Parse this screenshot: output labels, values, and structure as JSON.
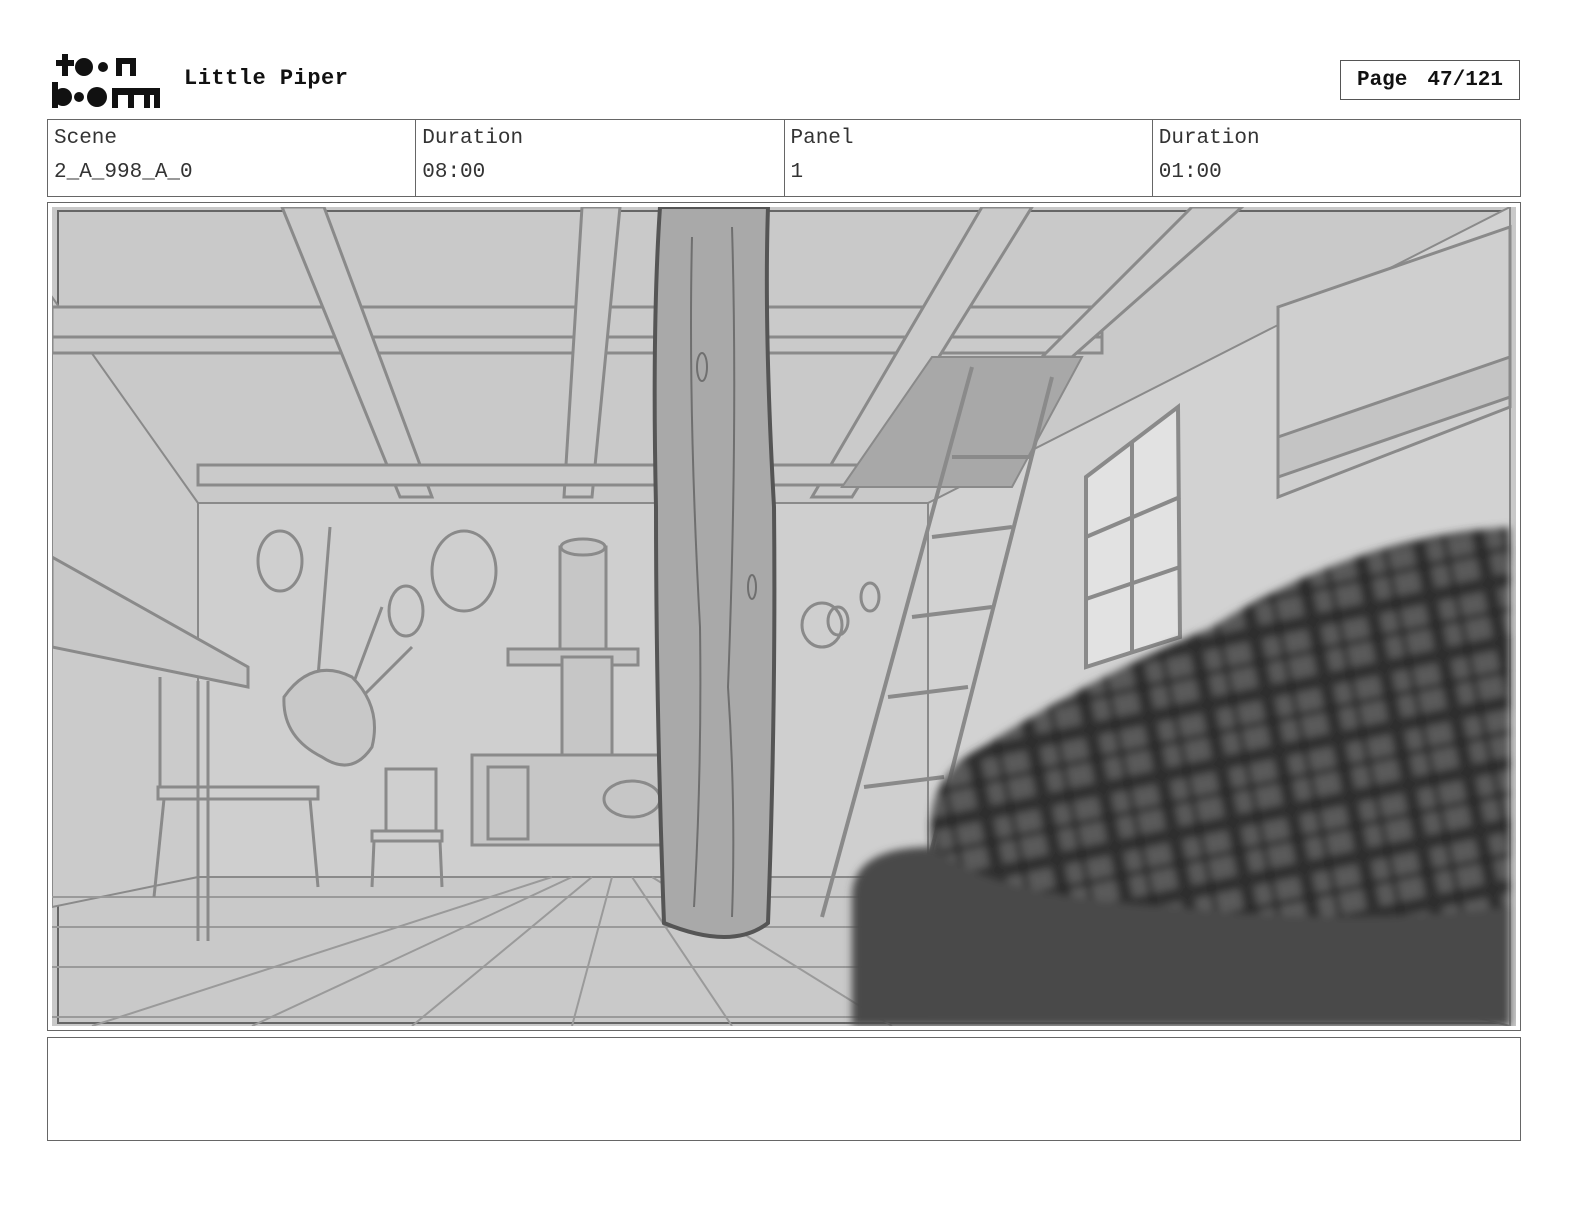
{
  "header": {
    "logo_alt": "toon boom",
    "project_title": "Little Piper",
    "page_label": "Page",
    "page_value": "47/121"
  },
  "info": [
    {
      "label": "Scene",
      "value": "2_A_998_A_0"
    },
    {
      "label": "Duration",
      "value": "08:00"
    },
    {
      "label": "Panel",
      "value": "1"
    },
    {
      "label": "Duration",
      "value": "01:00"
    }
  ],
  "notes": {
    "text": ""
  },
  "colors": {
    "sketch_bg": "#c9c9c9",
    "line": "#8a8a8a",
    "dark": "#333333",
    "plaid": "#4a4a4a"
  }
}
